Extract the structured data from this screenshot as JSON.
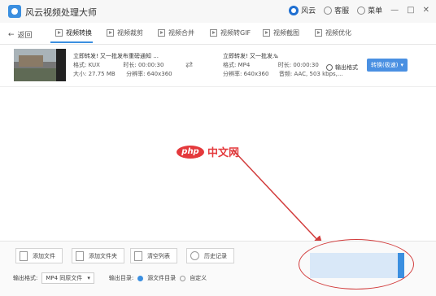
{
  "app": {
    "title": "风云视频处理大师"
  },
  "titlebar": {
    "brand": "风云",
    "service": "客服",
    "menu": "菜单",
    "minimize": "—",
    "maximize": "□",
    "close": "✕"
  },
  "toolbar": {
    "back": "返回",
    "tabs": [
      {
        "label": "视频转换"
      },
      {
        "label": "视频裁剪"
      },
      {
        "label": "视频合并"
      },
      {
        "label": "视频转GIF"
      },
      {
        "label": "视频截图"
      },
      {
        "label": "视频优化"
      }
    ]
  },
  "file": {
    "source": {
      "name": "立即转发! 又一批发布重磅通知 ...",
      "format_label": "格式: KUX",
      "duration_label": "时长: 00:00:30",
      "size_label": "大小: 27.75 MB",
      "resolution_label": "分辨率: 640x360"
    },
    "target": {
      "name": "立即转发! 又一批发...",
      "format_label": "格式: MP4",
      "duration_label": "时长: 00:00:30",
      "resolution_label": "分辨率: 640x360",
      "audio_label": "音频: AAC, 503 kbps,..."
    },
    "output_format_link": "输出格式",
    "convert_button": "转换(极速)"
  },
  "watermark": {
    "badge": "php",
    "text": "中文网"
  },
  "bottom": {
    "add_file": "添加文件",
    "add_folder": "添加文件夹",
    "clear_list": "清空列表",
    "history": "历史记录",
    "output_format_label": "输出格式:",
    "output_format_value": "MP4 同原文件",
    "output_dir_label": "输出目录:",
    "source_dir_option": "源文件目录",
    "custom_option": "自定义"
  }
}
